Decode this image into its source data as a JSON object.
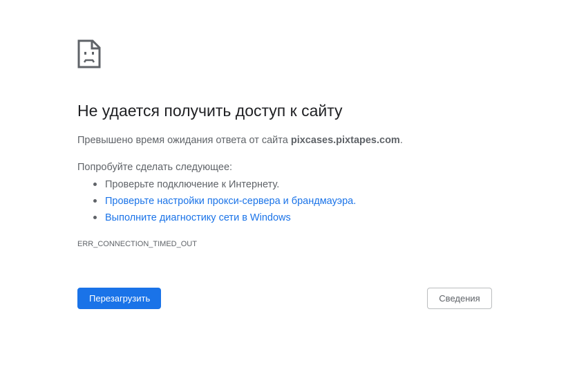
{
  "error": {
    "title": "Не удается получить доступ к сайту",
    "summary_prefix": "Превышено время ожидания ответа от сайта ",
    "host": "pixcases.pixtapes.com",
    "summary_suffix": ".",
    "suggestions_heading": "Попробуйте сделать следующее:",
    "suggestions": [
      {
        "text": "Проверьте подключение к Интернету.",
        "is_link": false
      },
      {
        "text": "Проверьте настройки прокси-сервера и брандмауэра.",
        "is_link": true
      },
      {
        "text": "Выполните диагностику сети в Windows",
        "is_link": true
      }
    ],
    "code": "ERR_CONNECTION_TIMED_OUT",
    "icon": "sad-page-icon"
  },
  "buttons": {
    "reload_label": "Перезагрузить",
    "details_label": "Сведения"
  },
  "colors": {
    "title": "#202124",
    "text": "#5f6368",
    "link": "#1a73e8",
    "primary_button": "#1a73e8"
  }
}
